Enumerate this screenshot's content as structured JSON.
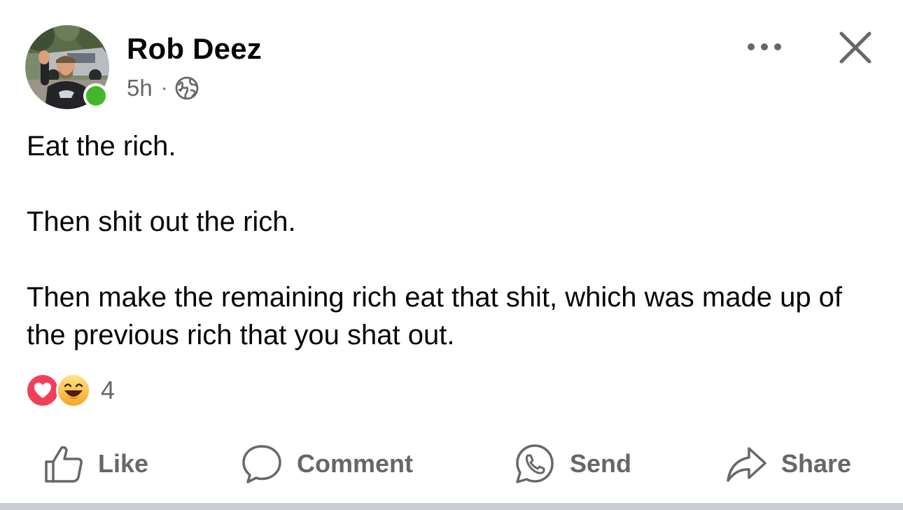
{
  "post": {
    "author_name": "Rob Deez",
    "timestamp": "5h",
    "separator": "·",
    "privacy_icon": "globe-icon",
    "online_status_color": "#42b72a",
    "body_paragraphs": [
      "Eat the rich.",
      "Then shit out the rich.",
      "Then make the remaining rich eat that shit, which was made up of the previous rich that you shat out."
    ],
    "reactions": {
      "types": [
        "love",
        "haha"
      ],
      "count": "4"
    }
  },
  "header_actions": {
    "more_icon": "more-horizontal-icon",
    "close_icon": "close-icon"
  },
  "actions": {
    "like_label": "Like",
    "comment_label": "Comment",
    "send_label": "Send",
    "share_label": "Share"
  },
  "colors": {
    "text_primary": "#050505",
    "text_secondary": "#65676b",
    "love_red": "#f33e58",
    "haha_yellow": "#f7b125",
    "divider": "#cacdd2"
  }
}
